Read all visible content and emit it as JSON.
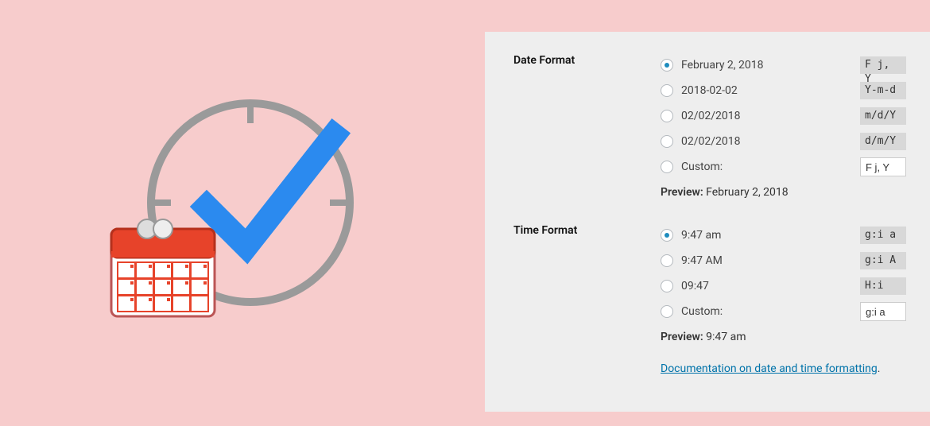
{
  "date": {
    "label": "Date Format",
    "options": [
      {
        "example": "February 2, 2018",
        "code": "F j, Y",
        "selected": true
      },
      {
        "example": "2018-02-02",
        "code": "Y-m-d",
        "selected": false
      },
      {
        "example": "02/02/2018",
        "code": "m/d/Y",
        "selected": false
      },
      {
        "example": "02/02/2018",
        "code": "d/m/Y",
        "selected": false
      }
    ],
    "custom_label": "Custom:",
    "custom_value": "F j, Y",
    "preview_label": "Preview:",
    "preview_value": "February 2, 2018"
  },
  "time": {
    "label": "Time Format",
    "options": [
      {
        "example": "9:47 am",
        "code": "g:i a",
        "selected": true
      },
      {
        "example": "9:47 AM",
        "code": "g:i A",
        "selected": false
      },
      {
        "example": "09:47",
        "code": "H:i",
        "selected": false
      }
    ],
    "custom_label": "Custom:",
    "custom_value": "g:i a",
    "preview_label": "Preview:",
    "preview_value": "9:47 am"
  },
  "doc_link": "Documentation on date and time formatting"
}
